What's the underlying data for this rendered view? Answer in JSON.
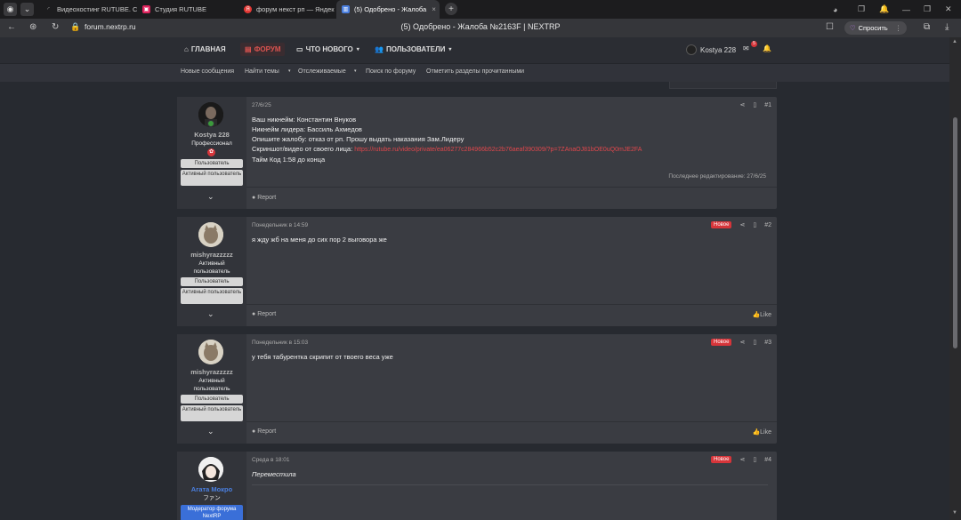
{
  "browser": {
    "tabs": [
      {
        "label": "Видеохостинг RUTUBE. С",
        "close": ""
      },
      {
        "label": "Студия RUTUBE",
        "close": ""
      },
      {
        "label": "форум некст рп — Яндекс",
        "close": ""
      },
      {
        "label": "(5) Одобрено - Жалоба",
        "close": "×"
      }
    ],
    "url": "forum.nextrp.ru",
    "page_title": "(5) Одобрено - Жалоба №2163F | NEXTRP",
    "ask_label": "Спросить"
  },
  "site_nav": {
    "items": [
      "ГЛАВНАЯ",
      "ФОРУМ",
      "ЧТО НОВОГО",
      "ПОЛЬЗОВАТЕЛИ"
    ],
    "user": "Kostya 228",
    "notif_count": "5"
  },
  "sub_nav": [
    "Новые сообщения",
    "Найти темы",
    "Отслеживаемые",
    "Поиск по форуму",
    "Отметить разделы прочитанными"
  ],
  "posts": [
    {
      "username": "Kostya 228",
      "title": "Профессионал",
      "badges": [
        "Пользователь",
        "Активный пользователь"
      ],
      "date": "27/6/25",
      "number": "#1",
      "lines": [
        "Ваш никнейм: Константин Внуков",
        "Никнейм лидера: Бассиль Ахмедов",
        "Опишите жалобу: отказ от рп. Прошу выдать наказания Зам.Лидеру",
        "Скриншот/видео от своего лица: ",
        "Тайм Код 1:58 до конца"
      ],
      "link": "https://rutube.ru/video/private/ea06277c284966b52c2b76aeaf390309/?p=7ZAnaOJ81bOE0uQ0mJE2FA",
      "last_edit": "Последнее редактирование: 27/6/25",
      "report": "Report"
    },
    {
      "username": "mishyrazzzzz",
      "title": "Активный пользователь",
      "badges": [
        "Пользователь",
        "Активный пользователь"
      ],
      "date": "Понедельник в 14:59",
      "new_label": "Новое",
      "number": "#2",
      "text": "я жду жб на меня до сих пор 2 выговора же",
      "report": "Report",
      "like": "Like"
    },
    {
      "username": "mishyrazzzzz",
      "title": "Активный пользователь",
      "badges": [
        "Пользователь",
        "Активный пользователь"
      ],
      "date": "Понедельник в 15:03",
      "new_label": "Новое",
      "number": "#3",
      "text": "у тебя табурентка скрипит от твоего веса уже",
      "report": "Report",
      "like": "Like"
    },
    {
      "username": "Агата Мокро",
      "title": "ファン",
      "badges": [
        "Модератор форума NextRP"
      ],
      "date": "Среда в 18:01",
      "new_label": "Новое",
      "number": "#4",
      "text": "Переместила"
    }
  ],
  "colors": {
    "accent": "#d9534f",
    "moderator_badge": "#3a6fd8",
    "username_mod": "#4a7fe0"
  }
}
